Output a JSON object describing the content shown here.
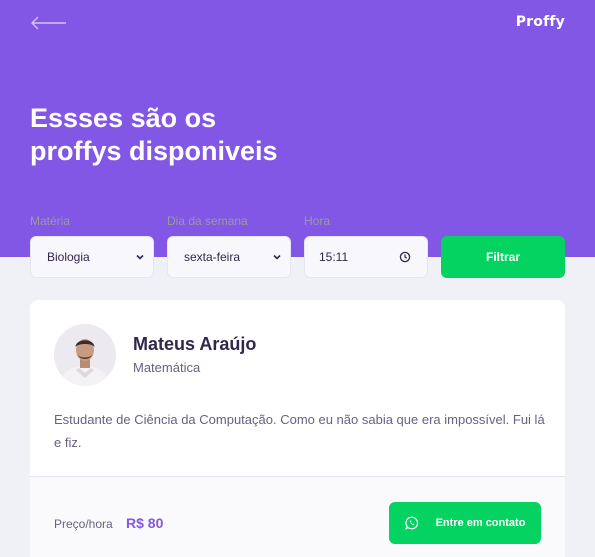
{
  "header": {
    "logo": "Proffy",
    "title_line1": "Essses são os",
    "title_line2": "proffys disponiveis"
  },
  "filters": {
    "subject": {
      "label": "Matéria",
      "value": "Biologia"
    },
    "weekday": {
      "label": "Dia da semana",
      "value": "sexta-feira"
    },
    "time": {
      "label": "Hora",
      "value": "15:11"
    },
    "submit_label": "Filtrar"
  },
  "teacher": {
    "name": "Mateus Araújo",
    "subject": "Matemática",
    "bio": "Estudante de Ciência da Computação. Como eu não sabia que era impossível. Fui lá e fiz.",
    "price_label": "Preço/hora",
    "price": "R$ 80",
    "contact_label": "Entre em contato"
  },
  "icons": {
    "back": "arrow-left-icon",
    "dropdown": "chevron-down-icon",
    "clock": "clock-icon",
    "whatsapp": "whatsapp-icon"
  },
  "colors": {
    "primary": "#8257E5",
    "secondary": "#04D361",
    "background": "#F0F0F7",
    "text_title": "#32264D",
    "text_base": "#6A6180"
  }
}
